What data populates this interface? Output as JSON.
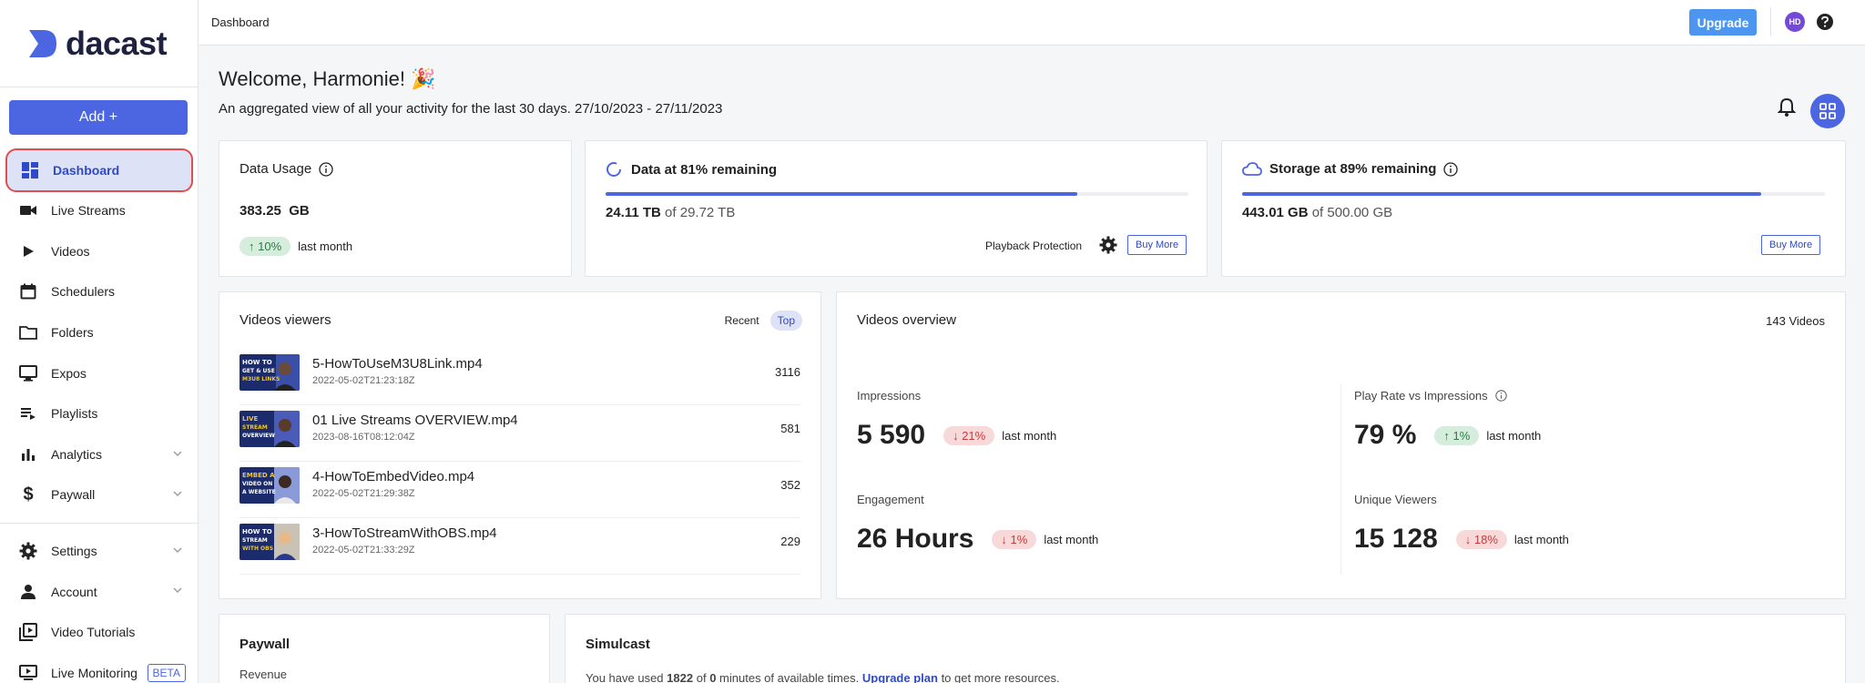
{
  "app": {
    "brand": "dacast",
    "brand_color": "#4c66e2"
  },
  "sidebar": {
    "add_label": "Add +",
    "items": [
      {
        "label": "Dashboard",
        "icon": "dashboard-icon"
      },
      {
        "label": "Live Streams",
        "icon": "video-camera-icon"
      },
      {
        "label": "Videos",
        "icon": "play-icon"
      },
      {
        "label": "Schedulers",
        "icon": "calendar-icon"
      },
      {
        "label": "Folders",
        "icon": "folder-icon"
      },
      {
        "label": "Expos",
        "icon": "monitor-icon"
      },
      {
        "label": "Playlists",
        "icon": "playlist-icon"
      },
      {
        "label": "Analytics",
        "icon": "bar-chart-icon"
      },
      {
        "label": "Paywall",
        "icon": "dollar-icon"
      },
      {
        "label": "Settings",
        "icon": "gear-icon"
      },
      {
        "label": "Account",
        "icon": "person-icon"
      },
      {
        "label": "Video Tutorials",
        "icon": "video-library-icon"
      },
      {
        "label": "Live Monitoring",
        "icon": "live-monitor-icon",
        "badge": "BETA"
      }
    ]
  },
  "topbar": {
    "breadcrumb": "Dashboard",
    "upgrade_label": "Upgrade",
    "avatar_initials": "HD"
  },
  "main": {
    "welcome": "Welcome, Harmonie! 🎉",
    "subtitle": "An aggregated view of all your activity for the last 30 days. 27/10/2023 - 27/11/2023"
  },
  "data_usage": {
    "title": "Data Usage",
    "value": "383.25  GB",
    "change": "10%",
    "change_label": "last month"
  },
  "data_remaining": {
    "title": "Data at 81% remaining",
    "used": "24.11 TB",
    "total": "of 29.72 TB",
    "progress": 0.81,
    "protection_label": "Playback Protection",
    "buy_label": "Buy More"
  },
  "storage": {
    "title": "Storage at 89% remaining",
    "used": "443.01 GB",
    "total": "of 500.00 GB",
    "progress": 0.89,
    "buy_label": "Buy More"
  },
  "videos_viewers": {
    "title": "Videos viewers",
    "tab_recent": "Recent",
    "tab_top": "Top",
    "rows": [
      {
        "name": "5-HowToUseM3U8Link.mp4",
        "date": "2022-05-02T21:23:18Z",
        "count": "3116",
        "thumb": [
          "HOW TO",
          "GET & USE",
          "M3U8 LINKS"
        ]
      },
      {
        "name": "01 Live Streams OVERVIEW.mp4",
        "date": "2023-08-16T08:12:04Z",
        "count": "581",
        "thumb": [
          "LIVE",
          "STREAM",
          "OVERVIEW"
        ]
      },
      {
        "name": "4-HowToEmbedVideo.mp4",
        "date": "2022-05-02T21:29:38Z",
        "count": "352",
        "thumb": [
          "EMBED A",
          "VIDEO ON",
          "A WEBSITE"
        ]
      },
      {
        "name": "3-HowToStreamWithOBS.mp4",
        "date": "2022-05-02T21:33:29Z",
        "count": "229",
        "thumb": [
          "HOW TO",
          "STREAM",
          "WITH OBS"
        ]
      }
    ]
  },
  "videos_overview": {
    "title": "Videos overview",
    "count": "143 Videos",
    "impressions": {
      "label": "Impressions",
      "value": "5 590",
      "change": "21%",
      "change_label": "last month"
    },
    "play_rate": {
      "label": "Play Rate vs Impressions",
      "value": "79 %",
      "change": "1%",
      "change_label": "last month"
    },
    "engagement": {
      "label": "Engagement",
      "value": "26 Hours",
      "change": "1%",
      "change_label": "last month"
    },
    "unique_viewers": {
      "label": "Unique Viewers",
      "value": "15 128",
      "change": "18%",
      "change_label": "last month"
    }
  },
  "paywall": {
    "title": "Paywall",
    "revenue_label": "Revenue"
  },
  "simulcast": {
    "title": "Simulcast",
    "text_before": "You have used",
    "used": "1822",
    "text_of": "of",
    "available": "0",
    "text_after": "minutes of available times.",
    "upgrade_link": "Upgrade plan",
    "text_end": "to get more resources."
  }
}
